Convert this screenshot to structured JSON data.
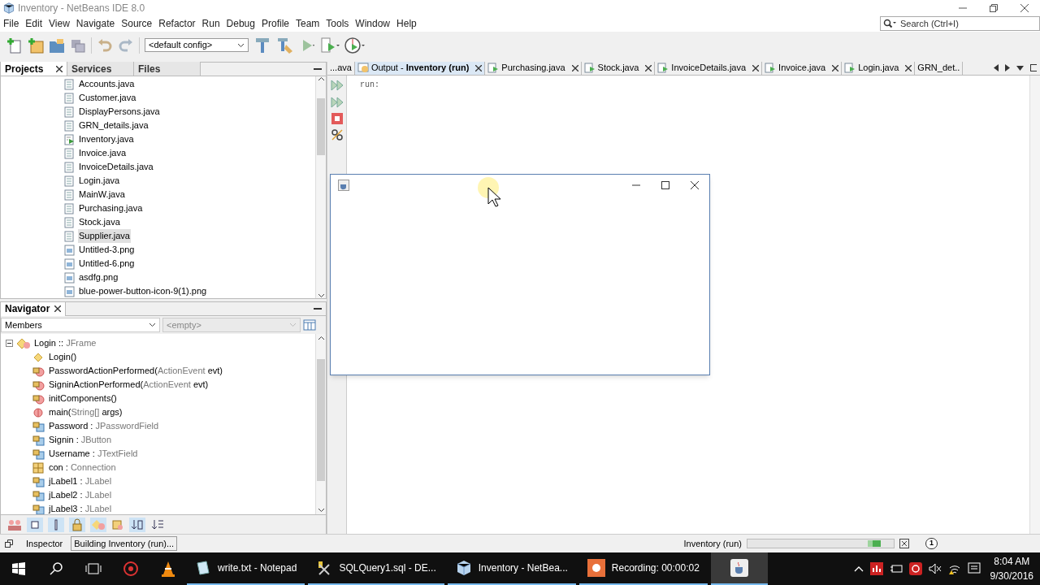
{
  "window": {
    "title": "Inventory - NetBeans IDE 8.0"
  },
  "menu": [
    "File",
    "Edit",
    "View",
    "Navigate",
    "Source",
    "Refactor",
    "Run",
    "Debug",
    "Profile",
    "Team",
    "Tools",
    "Window",
    "Help"
  ],
  "search": {
    "placeholder": "Search (Ctrl+I)"
  },
  "toolbar": {
    "config": "<default config>"
  },
  "left_tabs": [
    {
      "label": "Projects",
      "selected": true
    },
    {
      "label": "Services",
      "selected": false
    },
    {
      "label": "Files",
      "selected": false
    }
  ],
  "files": [
    {
      "name": "Accounts.java",
      "kind": "java",
      "selected": false
    },
    {
      "name": "Customer.java",
      "kind": "java",
      "selected": false
    },
    {
      "name": "DisplayPersons.java",
      "kind": "java",
      "selected": false
    },
    {
      "name": "GRN_details.java",
      "kind": "java",
      "selected": false
    },
    {
      "name": "Inventory.java",
      "kind": "main",
      "selected": false
    },
    {
      "name": "Invoice.java",
      "kind": "java",
      "selected": false
    },
    {
      "name": "InvoiceDetails.java",
      "kind": "java",
      "selected": false
    },
    {
      "name": "Login.java",
      "kind": "java",
      "selected": false
    },
    {
      "name": "MainW.java",
      "kind": "java",
      "selected": false
    },
    {
      "name": "Purchasing.java",
      "kind": "java",
      "selected": false
    },
    {
      "name": "Stock.java",
      "kind": "java",
      "selected": false
    },
    {
      "name": "Supplier.java",
      "kind": "java",
      "selected": true
    },
    {
      "name": "Untitled-3.png",
      "kind": "image",
      "selected": false
    },
    {
      "name": "Untitled-6.png",
      "kind": "image",
      "selected": false
    },
    {
      "name": "asdfg.png",
      "kind": "image",
      "selected": false
    },
    {
      "name": "blue-power-button-icon-9(1).png",
      "kind": "image",
      "selected": false
    }
  ],
  "navigator": {
    "title": "Navigator",
    "filter": "Members",
    "filter2": {
      "value": "<empty>"
    },
    "root": {
      "name": "Login :: ",
      "type": "JFrame",
      "expanded": true,
      "children": [
        {
          "name": "Login()",
          "kind": "constructor"
        },
        {
          "name": "PasswordActionPerformed(",
          "type": "ActionEvent",
          "rest": " evt)",
          "kind": "method"
        },
        {
          "name": "SigninActionPerformed(",
          "type": "ActionEvent",
          "rest": " evt)",
          "kind": "method"
        },
        {
          "name": "initComponents()",
          "kind": "method"
        },
        {
          "name": "main(",
          "type": "String[]",
          "rest": " args)",
          "kind": "static"
        },
        {
          "name": "Password : ",
          "type": "JPasswordField",
          "kind": "field"
        },
        {
          "name": "Signin : ",
          "type": "JButton",
          "kind": "field"
        },
        {
          "name": "Username : ",
          "type": "JTextField",
          "kind": "field"
        },
        {
          "name": "con : ",
          "type": "Connection",
          "kind": "package"
        },
        {
          "name": "jLabel1 : ",
          "type": "JLabel",
          "kind": "field"
        },
        {
          "name": "jLabel2 : ",
          "type": "JLabel",
          "kind": "field"
        },
        {
          "name": "jLabel3 : ",
          "type": "JLabel",
          "kind": "field"
        }
      ]
    }
  },
  "editor_tabs": [
    {
      "label": "...ava",
      "kind": "partial",
      "selected": false
    },
    {
      "label": "Output - **Inventory (run)**",
      "kind": "output",
      "selected": true
    },
    {
      "label": "Purchasing.java",
      "kind": "java",
      "selected": false
    },
    {
      "label": "Stock.java",
      "kind": "java",
      "selected": false
    },
    {
      "label": "InvoiceDetails.java",
      "kind": "java",
      "selected": false
    },
    {
      "label": "Invoice.java",
      "kind": "java",
      "selected": false
    },
    {
      "label": "Login.java",
      "kind": "java",
      "selected": false
    },
    {
      "label": "GRN_det..",
      "kind": "partial",
      "selected": false
    }
  ],
  "output": {
    "text": "run:"
  },
  "status_bar": {
    "tab": "Inspector",
    "task": "Building Inventory (run)...",
    "process": "Inventory (run)",
    "notifications": "1"
  },
  "taskbar": {
    "apps": [
      {
        "label": "write.txt - Notepad",
        "kind": "notepad",
        "active": false
      },
      {
        "label": "SQLQuery1.sql - DE...",
        "kind": "sql",
        "active": false
      },
      {
        "label": "Inventory - NetBea...",
        "kind": "netbeans",
        "active": false
      },
      {
        "label": "Recording:  00:00:02",
        "kind": "recorder",
        "active": false
      },
      {
        "kind": "java",
        "active": true
      }
    ],
    "time": "8:04 AM",
    "date": "9/30/2016"
  }
}
